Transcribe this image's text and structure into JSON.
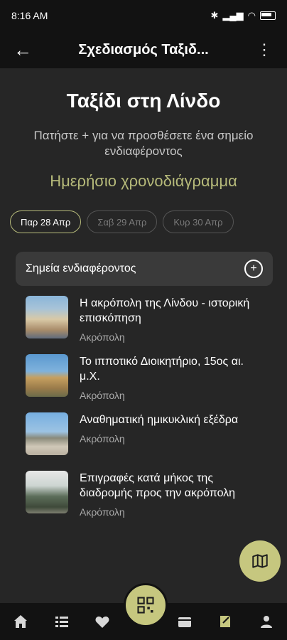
{
  "status_bar": {
    "time": "8:16 AM"
  },
  "app_bar": {
    "title": "Σχεδιασμός Ταξιδ..."
  },
  "trip": {
    "title": "Ταξίδι στη Λίνδο",
    "hint": "Πατήστε + για να προσθέσετε ένα σημείο ενδιαφέροντος",
    "schedule_title": "Ημερήσιο χρονοδιάγραμμα"
  },
  "days": [
    {
      "label": "Παρ 28 Απρ",
      "selected": true
    },
    {
      "label": "Σαβ 29 Απρ",
      "selected": false
    },
    {
      "label": "Κυρ 30 Απρ",
      "selected": false
    }
  ],
  "poi_section": {
    "label": "Σημεία ενδιαφέροντος",
    "add_icon": "plus-circle-icon"
  },
  "pois": [
    {
      "title": "Η ακρόπολη της Λίνδου - ιστορική επισκόπηση",
      "subtitle": "Ακρόπολη"
    },
    {
      "title": "Το ιπποτικό Διοικητήριο, 15ος αι. μ.Χ.",
      "subtitle": "Ακρόπολη"
    },
    {
      "title": "Αναθηματική ημικυκλική εξέδρα",
      "subtitle": "Ακρόπολη"
    },
    {
      "title": "Επιγραφές κατά μήκος της διαδρομής προς την ακρόπολη",
      "subtitle": "Ακρόπολη"
    }
  ],
  "bottom_nav": {
    "items": [
      "home-icon",
      "list-icon",
      "heart-icon",
      "qr-icon",
      "ticket-icon",
      "notebook-icon",
      "profile-icon"
    ],
    "active": "notebook-icon"
  },
  "colors": {
    "accent": "#c6c77f",
    "background": "#262626",
    "bar": "#121212"
  }
}
